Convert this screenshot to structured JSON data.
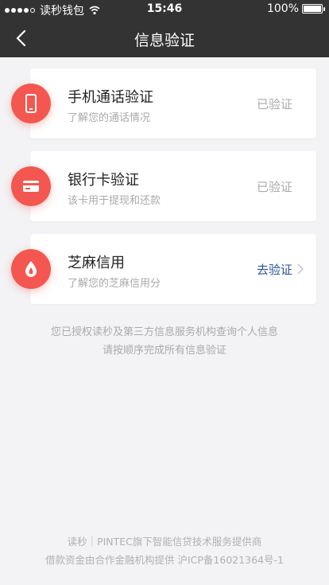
{
  "status_bar": {
    "carrier": "读秒钱包",
    "time": "15:46",
    "battery": "100%",
    "battery_level": 1.0
  },
  "nav": {
    "title": "信息验证",
    "back_icon": "chevron-left-icon"
  },
  "items": [
    {
      "title": "手机通话验证",
      "subtitle": "了解您的通话情况",
      "status": "已验证",
      "icon": "phone-icon"
    },
    {
      "title": "银行卡验证",
      "subtitle": "该卡用于提现和还款",
      "status": "已验证",
      "icon": "card-icon"
    },
    {
      "title": "芝麻信用",
      "subtitle": "了解您的芝麻信用分",
      "status": "去验证",
      "icon": "sesame-icon"
    }
  ],
  "notice": {
    "line1": "您已授权读秒及第三方信息服务机构查询个人信息",
    "line2": "请按顺序完成所有信息验证"
  },
  "footer": {
    "line1": "读秒｜PINTEC旗下智能信贷技术服务提供商",
    "line2": "借款资金由合作金融机构提供  沪ICP备16021364号-1"
  },
  "colors": {
    "accent": "#f4574f",
    "action": "#2a5599",
    "header_bg": "#333334"
  }
}
